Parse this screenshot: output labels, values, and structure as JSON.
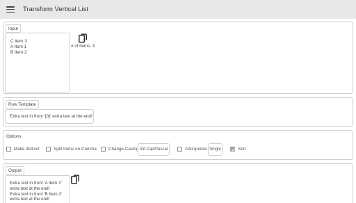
{
  "toolbar": {
    "menu_icon": "hamburger-menu-icon",
    "title": "Transform Vertical List"
  },
  "input": {
    "legend": "Input",
    "lines": [
      "C Item 3",
      "A Item 1",
      "B Item 2"
    ],
    "copy_icon": "copy-icon",
    "count_label": "# of items: 3"
  },
  "row_template": {
    "legend": "Row Template",
    "value": "Extra text in front '{0}' extra text at the end!"
  },
  "options": {
    "legend": "Options",
    "make_distinct": {
      "label": "Make distinct",
      "checked": false
    },
    "split_comma": {
      "label": "Split Items on Comma",
      "checked": false
    },
    "change_casing": {
      "label": "Change Casing",
      "checked": false
    },
    "casing_value": "Init Cap/Pascal",
    "add_quotes": {
      "label": "Add quotes",
      "checked": false
    },
    "quotes_value": "Single",
    "sort": {
      "label": "Sort",
      "checked": true
    }
  },
  "output": {
    "legend": "Output",
    "lines": [
      "Extra text in front 'A Item 1'",
      "extra text at the end!",
      "Extra text in front 'B Item 2'",
      "extra text at the end!"
    ],
    "copy_icon": "copy-icon"
  }
}
